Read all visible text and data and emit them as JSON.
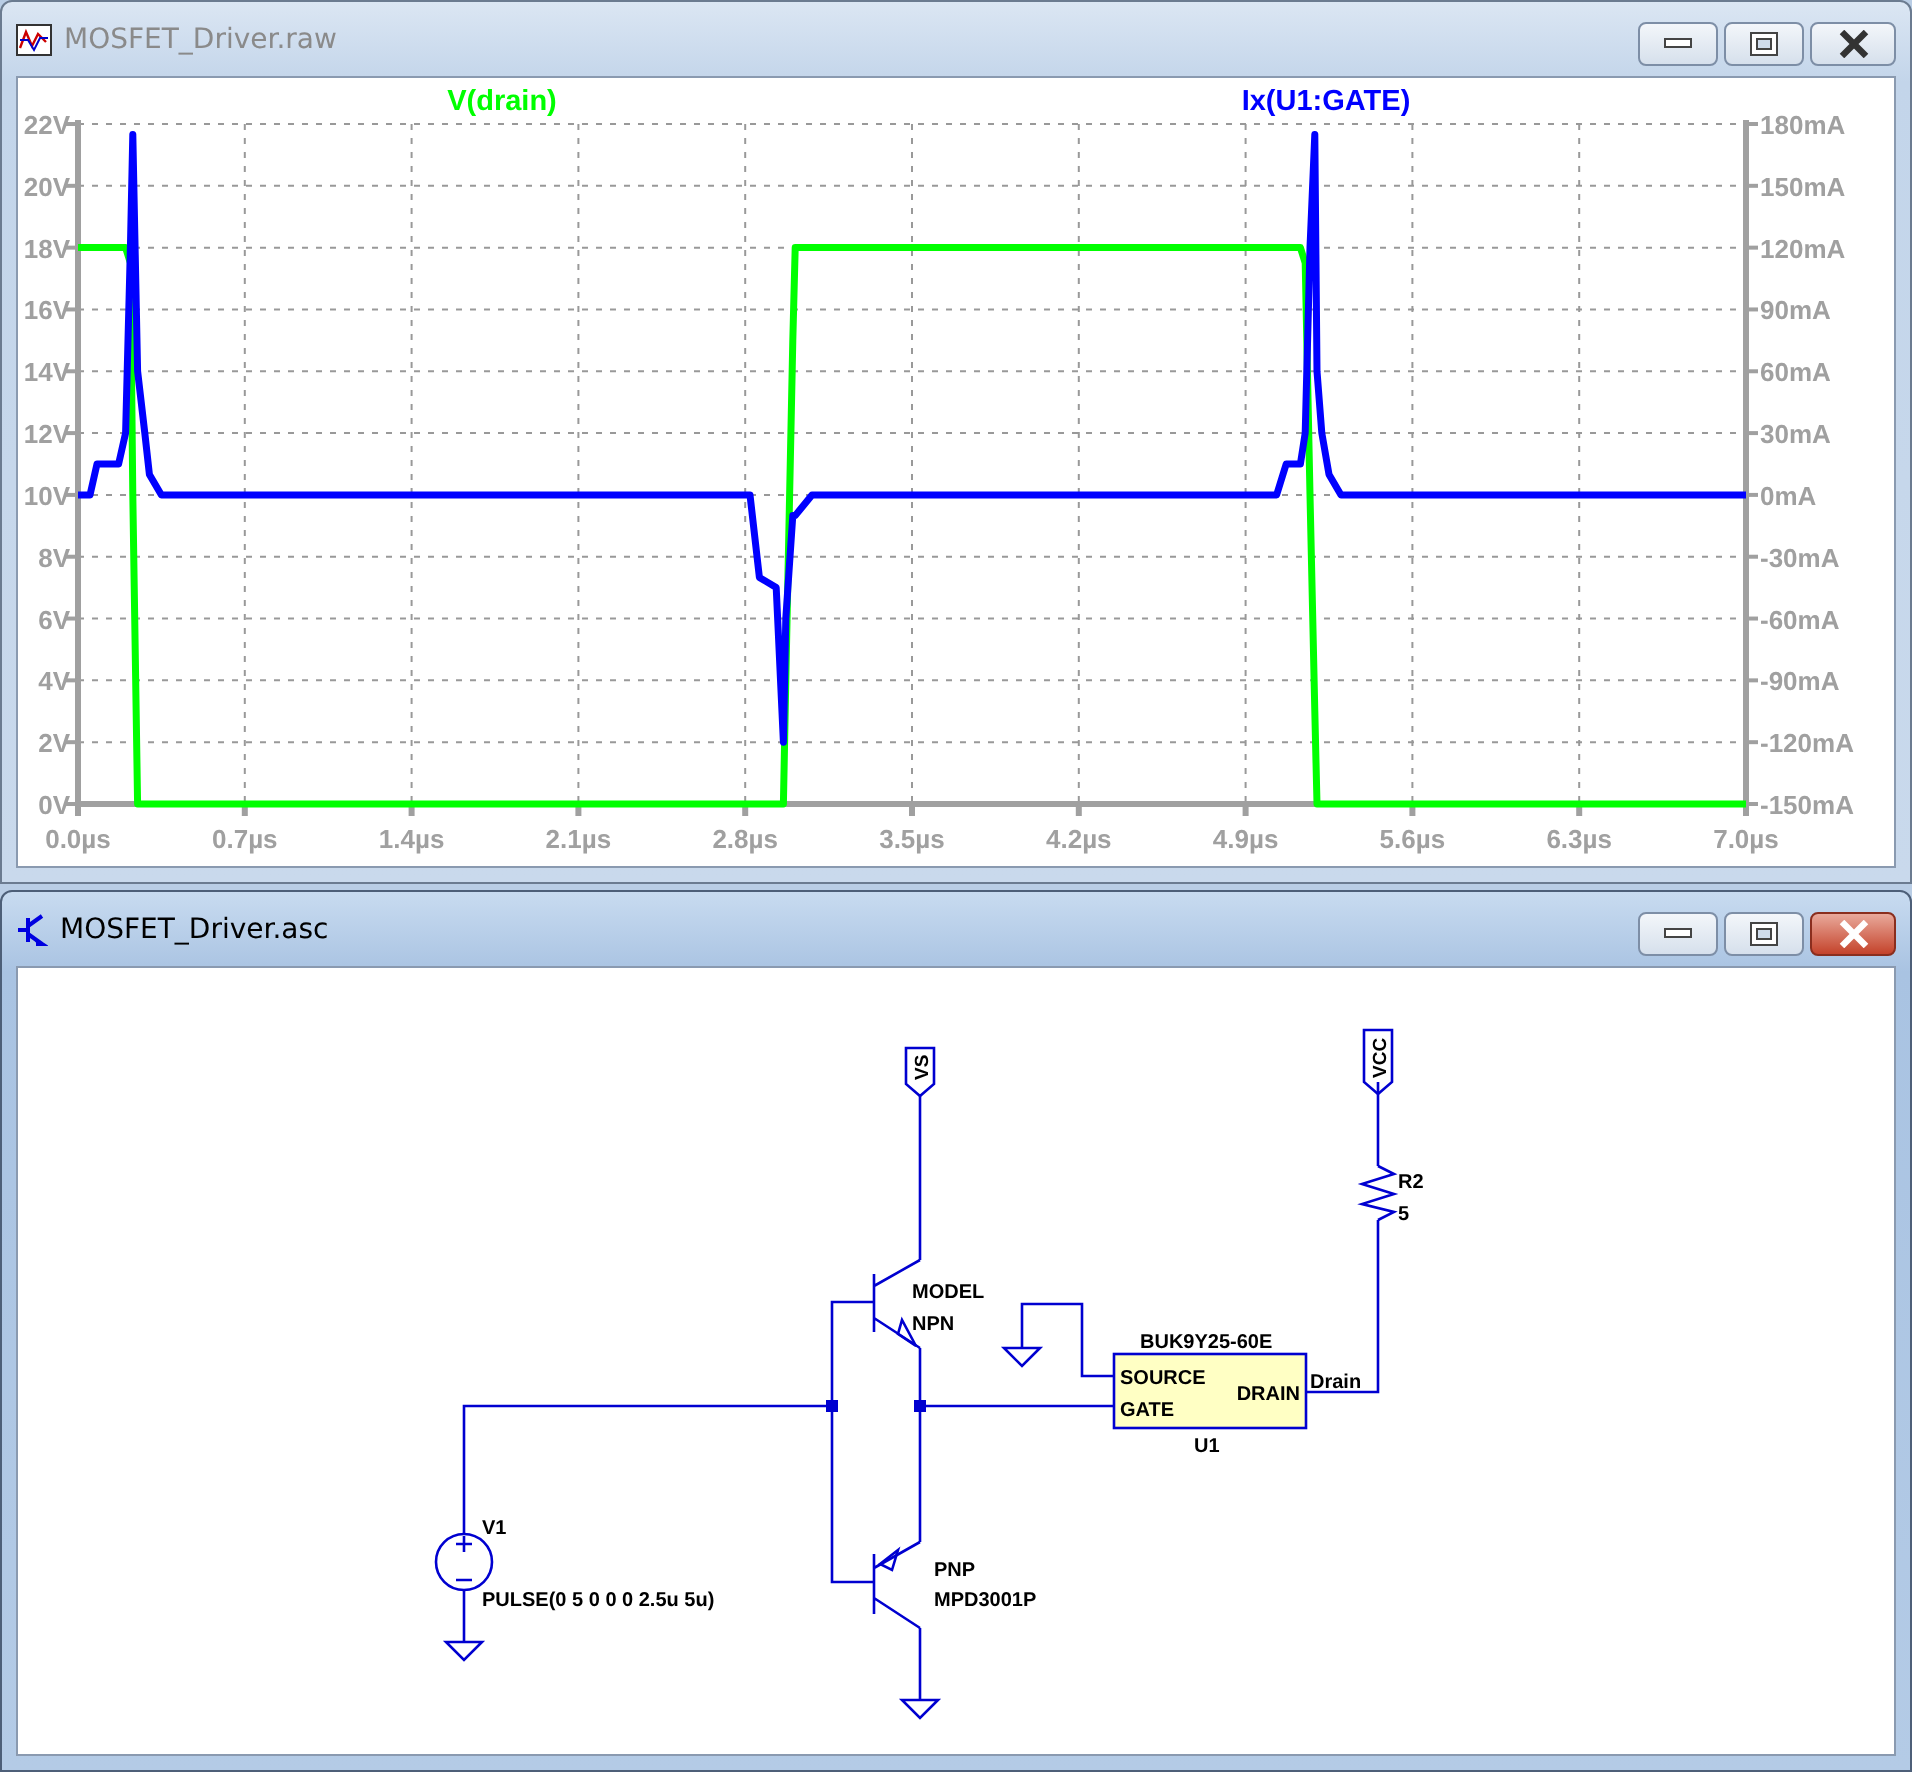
{
  "windows": [
    {
      "title": "MOSFET_Driver.raw",
      "active": false,
      "kind": "waveform",
      "chart_data": {
        "type": "line",
        "x": [
          0,
          0.05,
          0.08,
          0.17,
          0.2,
          0.22,
          0.23,
          0.25,
          0.28,
          0.3,
          0.35,
          2.82,
          2.86,
          2.93,
          2.96,
          2.97,
          3.0,
          3.01,
          3.08,
          5.03,
          5.07,
          5.13,
          5.15,
          5.17,
          5.19,
          5.2,
          5.22,
          5.25,
          5.3,
          7.0
        ],
        "series": [
          {
            "name": "V(drain)",
            "color": "#00ff00",
            "values": [
              18,
              18,
              18,
              18,
              18,
              17.5,
              10,
              0,
              0,
              0,
              0,
              0,
              0,
              0,
              0,
              4,
              15,
              18,
              18,
              18,
              18,
              18,
              17.5,
              10,
              3,
              0,
              0,
              0,
              0,
              0
            ]
          },
          {
            "name": "Ix(U1:GATE)",
            "color": "#0000ff",
            "axis": "y2",
            "values": [
              0,
              0,
              15,
              15,
              30,
              120,
              175,
              60,
              30,
              10,
              0,
              0,
              -40,
              -45,
              -120,
              -60,
              -10,
              -10,
              0,
              0,
              15,
              15,
              30,
              120,
              175,
              60,
              30,
              10,
              0,
              0
            ]
          }
        ],
        "grid": true,
        "xlim": [
          0,
          7
        ],
        "ylim": [
          0,
          22
        ],
        "y2lim": [
          -150,
          180
        ],
        "xticks": [
          {
            "value": 0,
            "label": "0.0µs"
          },
          {
            "value": 0.7,
            "label": "0.7µs"
          },
          {
            "value": 1.4,
            "label": "1.4µs"
          },
          {
            "value": 2.1,
            "label": "2.1µs"
          },
          {
            "value": 2.8,
            "label": "2.8µs"
          },
          {
            "value": 3.5,
            "label": "3.5µs"
          },
          {
            "value": 4.2,
            "label": "4.2µs"
          },
          {
            "value": 4.9,
            "label": "4.9µs"
          },
          {
            "value": 5.6,
            "label": "5.6µs"
          },
          {
            "value": 6.3,
            "label": "6.3µs"
          },
          {
            "value": 7.0,
            "label": "7.0µs"
          }
        ],
        "yticks": [
          {
            "value": 0,
            "label": "0V"
          },
          {
            "value": 2,
            "label": "2V"
          },
          {
            "value": 4,
            "label": "4V"
          },
          {
            "value": 6,
            "label": "6V"
          },
          {
            "value": 8,
            "label": "8V"
          },
          {
            "value": 10,
            "label": "10V"
          },
          {
            "value": 12,
            "label": "12V"
          },
          {
            "value": 14,
            "label": "14V"
          },
          {
            "value": 16,
            "label": "16V"
          },
          {
            "value": 18,
            "label": "18V"
          },
          {
            "value": 20,
            "label": "20V"
          },
          {
            "value": 22,
            "label": "22V"
          }
        ],
        "y2ticks": [
          {
            "value": -150,
            "label": "-150mA"
          },
          {
            "value": -120,
            "label": "-120mA"
          },
          {
            "value": -90,
            "label": "-90mA"
          },
          {
            "value": -60,
            "label": "-60mA"
          },
          {
            "value": -30,
            "label": "-30mA"
          },
          {
            "value": 0,
            "label": "0mA"
          },
          {
            "value": 30,
            "label": "30mA"
          },
          {
            "value": 60,
            "label": "60mA"
          },
          {
            "value": 90,
            "label": "90mA"
          },
          {
            "value": 120,
            "label": "120mA"
          },
          {
            "value": 150,
            "label": "150mA"
          },
          {
            "value": 180,
            "label": "180mA"
          }
        ]
      }
    },
    {
      "title": "MOSFET_Driver.asc",
      "active": true,
      "kind": "schematic",
      "schematic": {
        "net_flags": [
          "VS",
          "VCC"
        ],
        "npn": {
          "label": "MODEL",
          "model": "NPN"
        },
        "pnp": {
          "label": "PNP",
          "model": "MPD3001P"
        },
        "mosfet": {
          "part": "BUK9Y25-60E",
          "ref": "U1",
          "pins": [
            "SOURCE",
            "GATE",
            "DRAIN"
          ]
        },
        "net_label": "Drain",
        "resistor": {
          "ref": "R2",
          "value": "5"
        },
        "source": {
          "ref": "V1",
          "value": "PULSE(0 5 0 0 0 2.5u 5u)"
        }
      }
    }
  ]
}
